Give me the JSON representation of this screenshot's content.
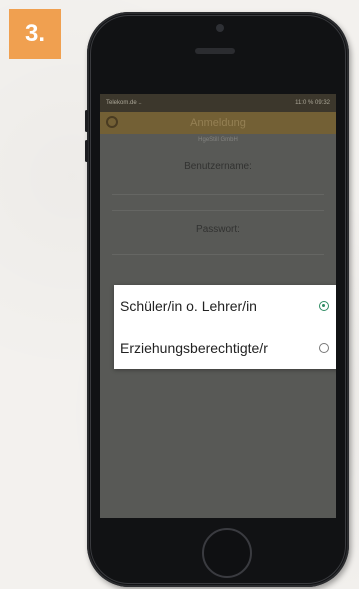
{
  "badge": {
    "step": "3."
  },
  "status": {
    "left": "Telekom.de ..",
    "right": "11:0 % 09:32"
  },
  "app": {
    "title": "Anmeldung",
    "company": "HgeStill GmbH"
  },
  "form": {
    "username_label": "Benutzername:",
    "password_label": "Passwort:"
  },
  "dialog": {
    "options": [
      {
        "label": "Schüler/in o. Lehrer/in",
        "selected": true
      },
      {
        "label": "Erziehungsberechtigte/r",
        "selected": false
      }
    ]
  },
  "colors": {
    "badge": "#f0a050",
    "appbar": "#7c6533",
    "radio_selected": "#2e8b62"
  }
}
